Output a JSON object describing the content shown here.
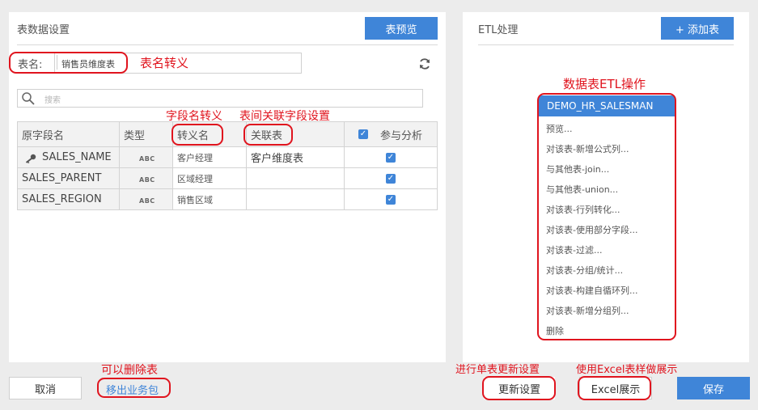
{
  "left_panel": {
    "title": "表数据设置",
    "preview_button": "表预览",
    "table_name_label": "表名:",
    "table_name_value": "销售员维度表",
    "search_placeholder": "搜索",
    "columns": [
      "原字段名",
      "类型",
      "转义名",
      "关联表",
      "参与分析"
    ],
    "rows": [
      {
        "field": "SALES_NAME",
        "type": "ABC",
        "alias": "客户经理",
        "relation": "客户维度表",
        "checked": true
      },
      {
        "field": "SALES_PARENT",
        "type": "ABC",
        "alias": "区域经理",
        "relation": "",
        "checked": true
      },
      {
        "field": "SALES_REGION",
        "type": "ABC",
        "alias": "销售区域",
        "relation": "",
        "checked": true
      }
    ]
  },
  "right_panel": {
    "title": "ETL处理",
    "add_button": "+ 添加表",
    "selected_table": "DEMO_HR_SALESMAN",
    "menu": [
      "预览...",
      "对该表-新增公式列...",
      "与其他表-join...",
      "与其他表-union...",
      "对该表-行列转化...",
      "对该表-使用部分字段...",
      "对该表-过滤...",
      "对该表-分组/统计...",
      "对该表-构建自循环列...",
      "对该表-新增分组列...",
      "删除"
    ]
  },
  "footer": {
    "cancel": "取消",
    "remove": "移出业务包",
    "update": "更新设置",
    "excel": "Excel展示",
    "save": "保存"
  },
  "annotations": {
    "table_name": "表名转义",
    "field_alias": "字段名转义",
    "relation": "表间关联字段设置",
    "etl": "数据表ETL操作",
    "remove": "可以删除表",
    "update": "进行单表更新设置",
    "excel": "使用Excel表样做展示"
  },
  "colors": {
    "accent": "#3f85d8",
    "annotation": "#e0141e"
  },
  "icons": [
    "key-icon",
    "search-icon",
    "refresh-icon",
    "checkbox-checked-icon"
  ]
}
